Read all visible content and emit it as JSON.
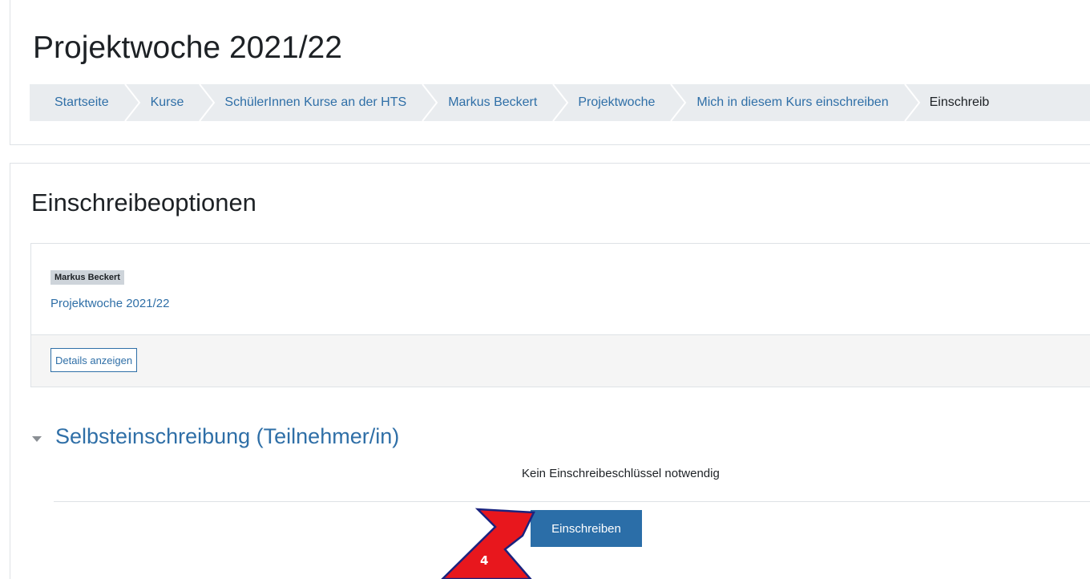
{
  "header": {
    "title": "Projektwoche 2021/22"
  },
  "breadcrumb": [
    {
      "label": "Startseite"
    },
    {
      "label": "Kurse"
    },
    {
      "label": "SchülerInnen Kurse an der HTS"
    },
    {
      "label": "Markus Beckert"
    },
    {
      "label": "Projektwoche"
    },
    {
      "label": "Mich in diesem Kurs einschreiben"
    },
    {
      "label": "Einschreib"
    }
  ],
  "main": {
    "title": "Einschreibeoptionen",
    "course": {
      "teacher": "Markus Beckert",
      "name": "Projektwoche 2021/22",
      "details_label": "Details anzeigen"
    },
    "self_enrolment": {
      "heading": "Selbsteinschreibung (Teilnehmer/in)",
      "note": "Kein Einschreibeschlüssel notwendig",
      "button_label": "Einschreiben"
    }
  },
  "annotation": {
    "step": "4",
    "arrow_color": "#e8171d",
    "outline_color": "#1a237e"
  },
  "colors": {
    "link": "#2f6fa7",
    "primary_button": "#2b6ea8",
    "breadcrumb_bg": "#e9ecef"
  }
}
